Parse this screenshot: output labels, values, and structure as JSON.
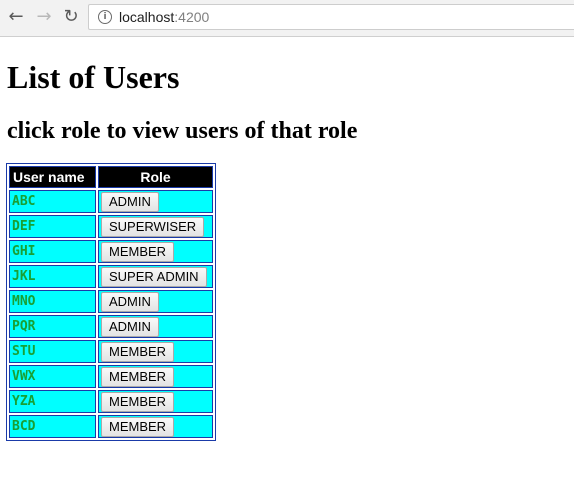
{
  "browser": {
    "url_host": "localhost",
    "url_port": ":4200"
  },
  "page": {
    "title": "List of Users",
    "subtitle": "click role to view users of that role"
  },
  "table": {
    "headers": [
      "User name",
      "Role"
    ],
    "rows": [
      {
        "name": "ABC",
        "role": "ADMIN"
      },
      {
        "name": "DEF",
        "role": "SUPERWISER"
      },
      {
        "name": "GHI",
        "role": "MEMBER"
      },
      {
        "name": "JKL",
        "role": "SUPER ADMIN"
      },
      {
        "name": "MNO",
        "role": "ADMIN"
      },
      {
        "name": "PQR",
        "role": "ADMIN"
      },
      {
        "name": "STU",
        "role": "MEMBER"
      },
      {
        "name": "VWX",
        "role": "MEMBER"
      },
      {
        "name": "YZA",
        "role": "MEMBER"
      },
      {
        "name": "BCD",
        "role": "MEMBER"
      }
    ]
  },
  "colors": {
    "header_bg": "#000000",
    "cell_bg": "#00ffff",
    "name_text": "#19a034",
    "border": "#1a3aa8"
  },
  "icons": {
    "back": "arrow-left-icon",
    "forward": "arrow-right-icon",
    "reload": "reload-icon",
    "info": "info-icon"
  }
}
